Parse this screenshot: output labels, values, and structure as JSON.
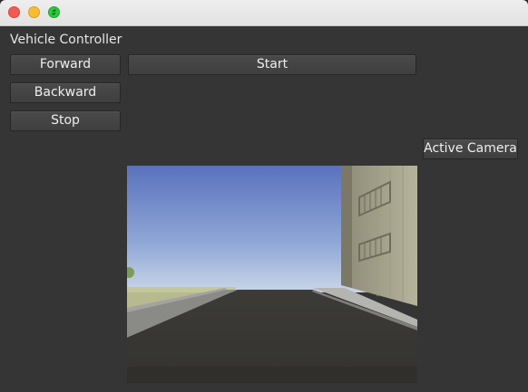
{
  "window": {
    "controls": [
      "close-icon",
      "minimize-icon",
      "maximize-icon"
    ],
    "colors": {
      "close": "#f25a52",
      "minimize": "#f7bd32",
      "maximize": "#2fc840",
      "background": "#353535"
    }
  },
  "app": {
    "title": "Vehicle Controller"
  },
  "controls": {
    "forward_label": "Forward",
    "backward_label": "Backward",
    "stop_label": "Stop",
    "start_label": "Start",
    "active_camera_label": "Active Camera"
  },
  "camera": {
    "content": "simulated road scene: blue sky, asphalt road, building with balconies on right, grass on left"
  }
}
